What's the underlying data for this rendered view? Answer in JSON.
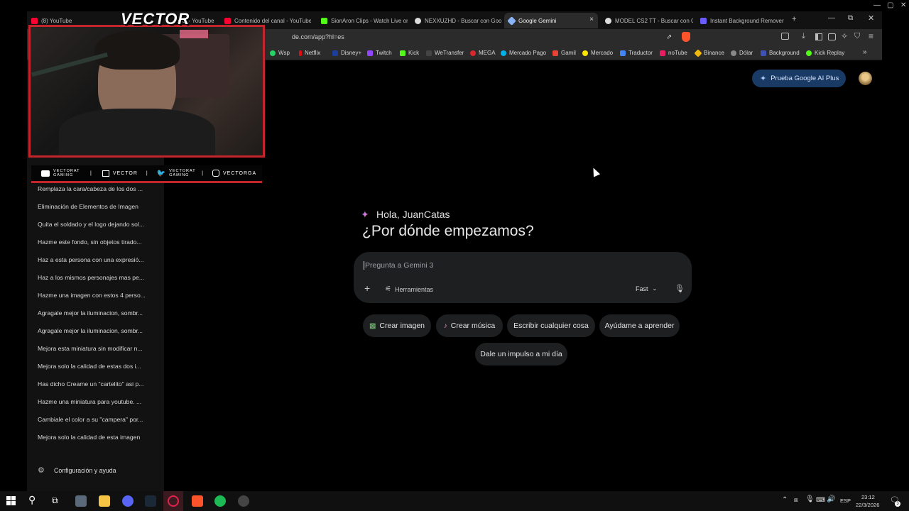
{
  "tabs": [
    {
      "label": "(8) YouTube",
      "color": "#ff0033"
    },
    {
      "label": "canal - YouTube",
      "color": "#ff0033"
    },
    {
      "label": "Contenido del canal - YouTube",
      "color": "#ff0033"
    },
    {
      "label": "SionAron Clips - Watch Live on",
      "color": "#53fc18"
    },
    {
      "label": "NEXXUZHD - Buscar con Goog",
      "color": "#dddddd"
    },
    {
      "label": "Google Gemini",
      "color": "#8ab4f8"
    },
    {
      "label": "MODEL CS2 TT - Buscar con G",
      "color": "#dddddd"
    },
    {
      "label": "Instant Background Remover",
      "color": "#6b5cff"
    }
  ],
  "url": "de.com/app?hl=es",
  "bookmarks": [
    {
      "label": "Wsp",
      "color": "#25d366"
    },
    {
      "label": "Netflix",
      "color": "#e50914"
    },
    {
      "label": "Disney+",
      "color": "#1c3d9a"
    },
    {
      "label": "Twitch",
      "color": "#9146ff"
    },
    {
      "label": "Kick",
      "color": "#53fc18"
    },
    {
      "label": "WeTransfer",
      "color": "#444444"
    },
    {
      "label": "MEGA",
      "color": "#d9272e"
    },
    {
      "label": "Mercado Pago",
      "color": "#00b1ea"
    },
    {
      "label": "Gamil",
      "color": "#ea4335"
    },
    {
      "label": "Mercado",
      "color": "#ffe600"
    },
    {
      "label": "Traductor",
      "color": "#4285f4"
    },
    {
      "label": "noTube",
      "color": "#e91e63"
    },
    {
      "label": "Binance",
      "color": "#f0b90b"
    },
    {
      "label": "Dólar",
      "color": "#888888"
    },
    {
      "label": "Background",
      "color": "#3f51b5"
    },
    {
      "label": "Kick Replay",
      "color": "#53fc18"
    }
  ],
  "overlay": {
    "brand": "VECTOR",
    "socials": [
      "VECTORAT GAMING",
      "VECTOR",
      "VECTORAT GAMING",
      "VECTORGA"
    ]
  },
  "sidebar": {
    "chats": [
      "Remplaza la cara/cabeza de los dos ...",
      "Eliminación de Elementos de Imagen",
      "Quita el soldado y el logo dejando sol...",
      "Hazme este fondo, sin objetos tirado...",
      "Haz a esta persona con una expresió...",
      "Haz a los mismos personajes mas pe...",
      "Hazme una imagen con estos 4 perso...",
      "Agragale mejor la iluminacion, sombr...",
      "Agragale mejor la iluminacion, sombr...",
      "Mejora esta miniatura sin modificar n...",
      "Mejora solo la calidad de estas dos i...",
      "Has dicho Creame un \"cartelito\" asi p...",
      "Hazme una miniatura para youtube. ...",
      "Cambiale el color a su \"campera\" por...",
      "Mejora solo la calidad de esta imagen"
    ],
    "settings": "Configuración y ayuda"
  },
  "header": {
    "upgrade_button": "Prueba Google AI Plus"
  },
  "main": {
    "greeting": "Hola, JuanCatas",
    "title": "¿Por dónde empezamos?",
    "placeholder": "Pregunta a Gemini 3",
    "tools": "Herramientas",
    "mode": "Fast",
    "chips": [
      "Crear imagen",
      "Crear música",
      "Escribir cualquier cosa",
      "Ayúdame a aprender",
      "Dale un impulso a mi día"
    ]
  },
  "taskbar": {
    "lang": "ESP",
    "time": "23:12",
    "date": "22/3/2026",
    "notifications": "3"
  }
}
